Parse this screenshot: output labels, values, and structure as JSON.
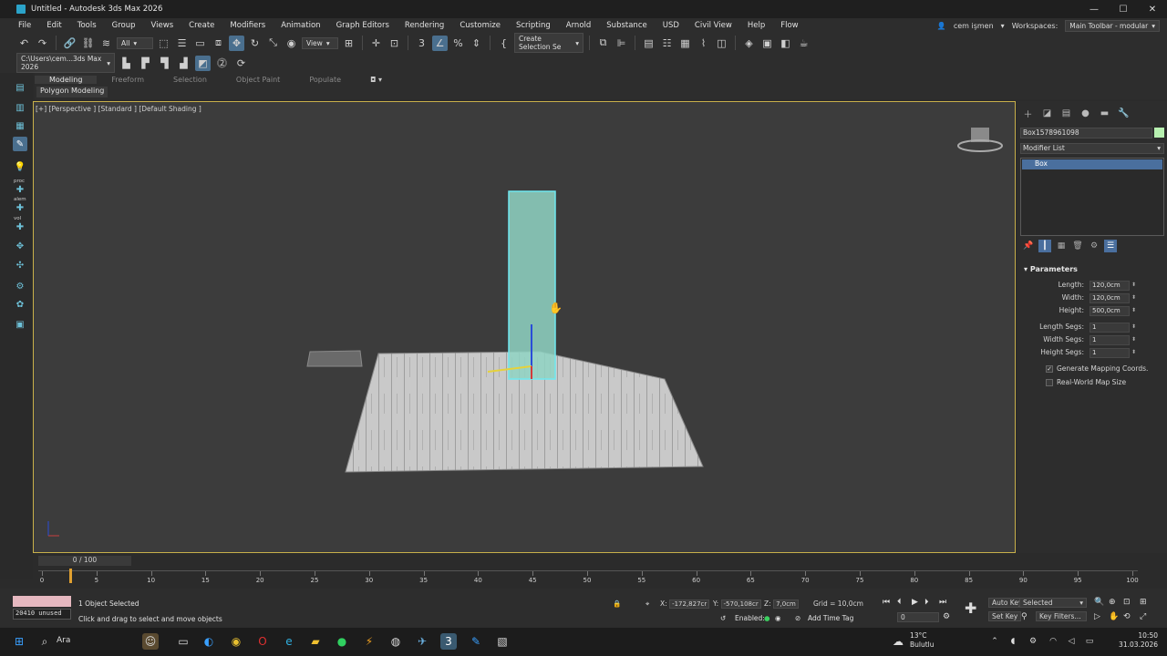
{
  "window": {
    "title": "Untitled - Autodesk 3ds Max 2026",
    "controls": [
      "—",
      "☐",
      "✕"
    ]
  },
  "menu": {
    "items": [
      "File",
      "Edit",
      "Tools",
      "Group",
      "Views",
      "Create",
      "Modifiers",
      "Animation",
      "Graph Editors",
      "Rendering",
      "Customize",
      "Scripting",
      "Arnold",
      "Substance",
      "USD",
      "Civil View",
      "Help",
      "Flow"
    ],
    "user": "cem işmen",
    "workspaces_label": "Workspaces:",
    "workspace_value": "Main Toolbar - modular"
  },
  "toolbar": {
    "filter_value": "All",
    "view_value": "View",
    "selection_set_placeholder": "Create Selection Se",
    "path_value": "C:\\Users\\cem...3ds Max 2026"
  },
  "ribbon": {
    "tabs": [
      "Modeling",
      "Freeform",
      "Selection",
      "Object Paint",
      "Populate"
    ],
    "active_tab": "Modeling",
    "subpanel": "Polygon Modeling"
  },
  "left_strip": {
    "labels": [
      "proc",
      "alem",
      "vol"
    ]
  },
  "viewport": {
    "label": "[+] [Perspective ] [Standard ] [Default Shading ]"
  },
  "command_panel": {
    "object_name": "Box1578961098",
    "object_color": "#b7f0b0",
    "modifier_list_label": "Modifier List",
    "stack_item": "Box",
    "rollout_title": "Parameters",
    "params": [
      {
        "label": "Length:",
        "value": "120,0cm"
      },
      {
        "label": "Width:",
        "value": "120,0cm"
      },
      {
        "label": "Height:",
        "value": "500,0cm"
      },
      {
        "label": "Length Segs:",
        "value": "1"
      },
      {
        "label": "Width Segs:",
        "value": "1"
      },
      {
        "label": "Height Segs:",
        "value": "1"
      }
    ],
    "generate_mapping": {
      "label": "Generate Mapping Coords.",
      "checked": true
    },
    "real_world": {
      "label": "Real-World Map Size",
      "checked": false
    }
  },
  "timeline": {
    "frame_label": "0 / 100",
    "ticks": [
      "0",
      "5",
      "10",
      "15",
      "20",
      "25",
      "30",
      "35",
      "40",
      "45",
      "50",
      "55",
      "60",
      "65",
      "70",
      "75",
      "80",
      "85",
      "90",
      "95",
      "100"
    ]
  },
  "status": {
    "memory": "20410 unused",
    "selection": "1 Object Selected",
    "hint": "Click and drag to select and move objects",
    "x_label": "X:",
    "x_value": "-172,827cr",
    "y_label": "Y:",
    "y_value": "-570,108cr",
    "z_label": "Z:",
    "z_value": "7,0cm",
    "grid": "Grid = 10,0cm",
    "enabled_label": "Enabled:",
    "add_time_tag": "Add Time Tag",
    "auto_key": "Auto Key",
    "set_key": "Set Key",
    "selected_value": "Selected",
    "key_filters": "Key Filters...",
    "frame_value": "0"
  },
  "taskbar": {
    "search_label": "Ara",
    "weather_temp": "13°C",
    "weather_desc": "Bulutlu",
    "time": "10:50",
    "date": "31.03.2026"
  }
}
